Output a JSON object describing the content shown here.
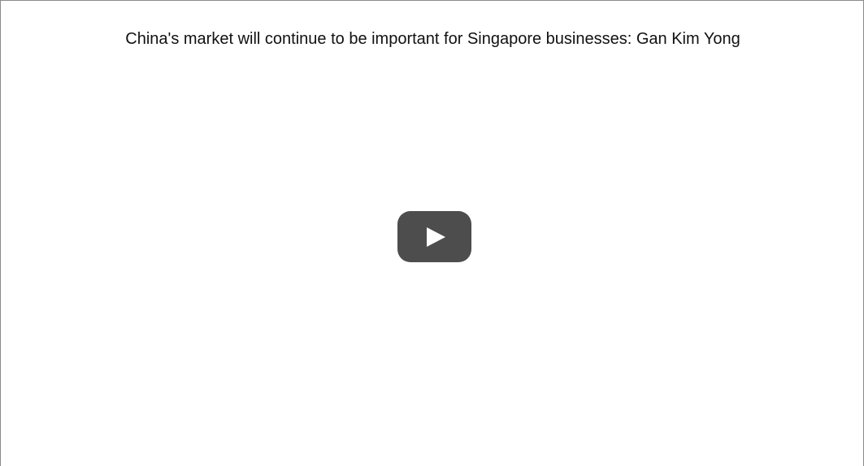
{
  "video": {
    "title": "China's market will continue to be important for Singapore businesses: Gan Kim Yong",
    "play_icon": "youtube-play-icon"
  },
  "colors": {
    "play_button_bg": "#4d4d4d",
    "play_triangle": "#ffffff",
    "frame_border": "#8a8a8a"
  }
}
